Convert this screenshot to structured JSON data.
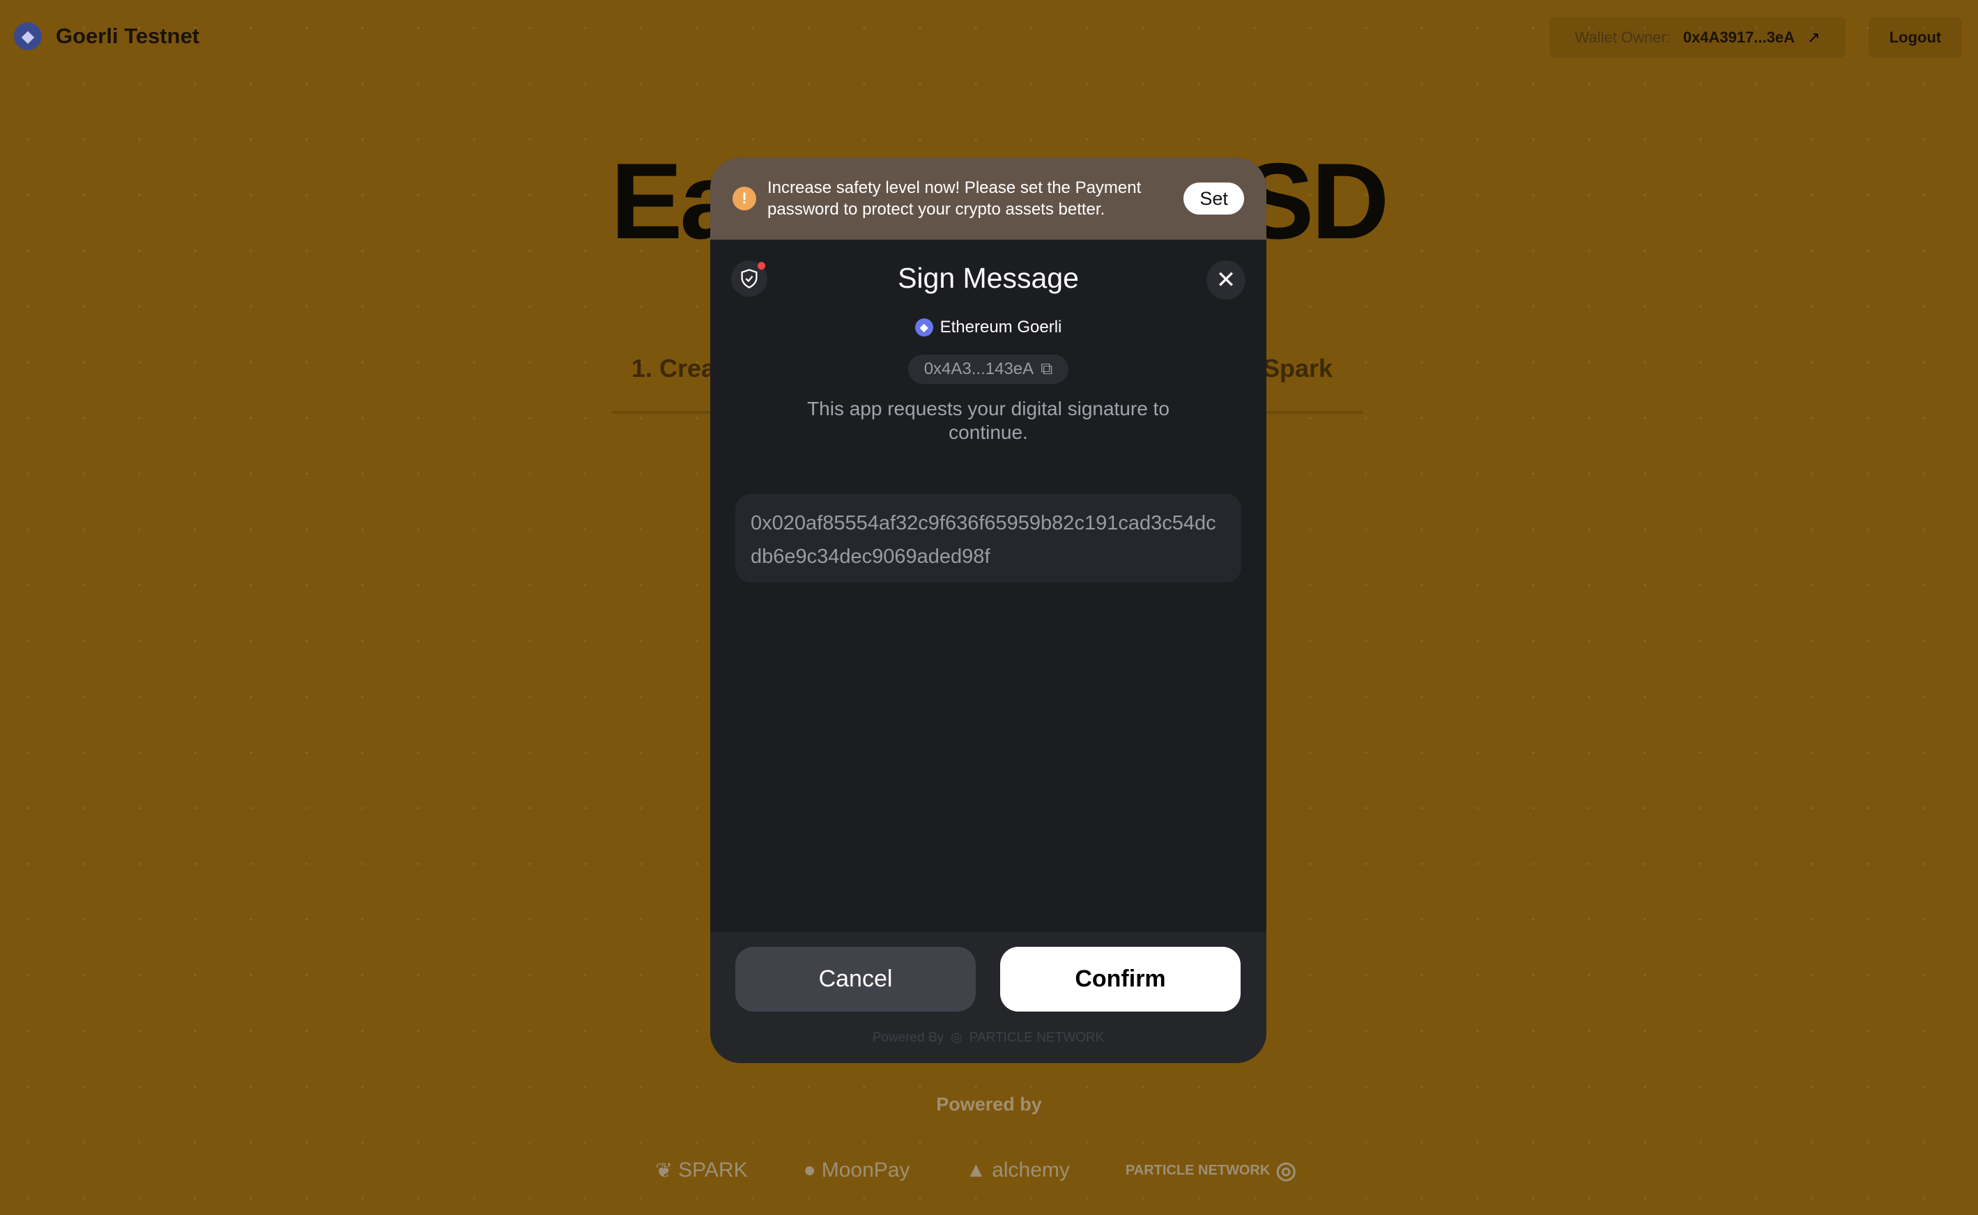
{
  "header": {
    "network": "Goerli Testnet",
    "wallet_label": "Wallet Owner:",
    "wallet_address": "0x4A3917...3eA",
    "logout": "Logout"
  },
  "hero": {
    "left_fragment": "Ea",
    "right_fragment": "SD"
  },
  "steps": {
    "left_fragment": "1. Crea",
    "right_fragment": "o Spark"
  },
  "modal": {
    "banner_text": "Increase safety level now! Please set the Payment password to protect your crypto assets better.",
    "banner_button": "Set",
    "title": "Sign Message",
    "network": "Ethereum Goerli",
    "address": "0x4A3...143eA",
    "description": "This app requests your digital signature to continue.",
    "message": "0x020af85554af32c9f636f65959b82c191cad3c54dcdb6e9c34dec9069aded98f",
    "cancel": "Cancel",
    "confirm": "Confirm",
    "powered_by": "Powered By",
    "powered_brand": "PARTICLE NETWORK"
  },
  "footer": {
    "powered_by": "Powered by",
    "logos": [
      "SPARK",
      "MoonPay",
      "alchemy",
      "PARTICLE NETWORK"
    ]
  },
  "colors": {
    "background": "#7c560d",
    "modal": "#1c1d21",
    "banner": "#63544a",
    "warning": "#f0a858"
  }
}
